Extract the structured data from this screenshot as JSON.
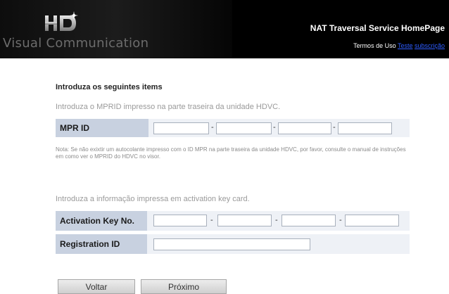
{
  "header": {
    "logo_text": "Visual Communication",
    "site_title": "NAT Traversal Service HomePage",
    "terms_label": "Termos de Uso",
    "link_test": "Teste",
    "link_subscription": "subscrição"
  },
  "form": {
    "section_title": "Introduza os seguintes items",
    "mpr_instruction": "Introduza o MPRID impresso na parte traseira da unidade HDVC.",
    "mpr_label": "MPR ID",
    "mpr_fields": [
      "",
      "",
      "",
      ""
    ],
    "note": "Nota: Se não exixtir um autocolante impresso com o ID MPR na parte traseira da unidade HDVC, por favor, consulte o manual de instruções em como ver o MPRID do HDVC no visor.",
    "activation_instruction": "Introduza a informação impressa em activation key card.",
    "activation_label": "Activation Key No.",
    "activation_fields": [
      "",
      "",
      "",
      ""
    ],
    "registration_label": "Registration ID",
    "registration_value": "",
    "separator": "-"
  },
  "buttons": {
    "back_label": "Voltar",
    "next_label": "Próximo"
  },
  "colors": {
    "header_bg": "#000000",
    "label_cell_bg": "#c8d1e0",
    "row_bg": "#eef1f6",
    "link": "#2d5cff"
  }
}
